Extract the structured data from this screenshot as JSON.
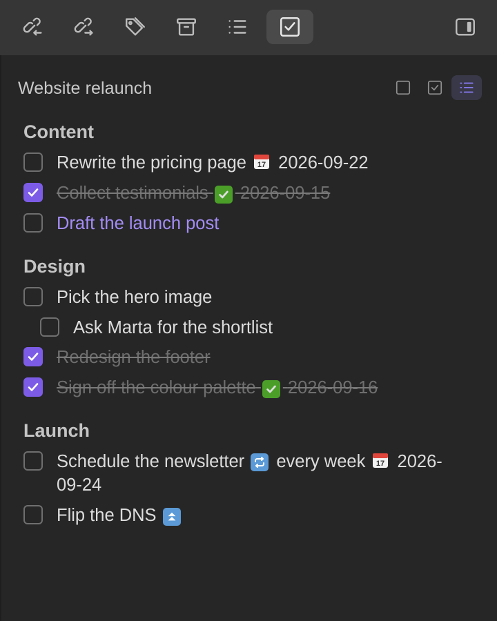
{
  "toolbar": {
    "buttons": [
      {
        "name": "backlinks-icon"
      },
      {
        "name": "outgoing-links-icon"
      },
      {
        "name": "tags-icon"
      },
      {
        "name": "archive-icon"
      },
      {
        "name": "outline-icon"
      },
      {
        "name": "tasks-icon",
        "active": true
      },
      {
        "name": "sidebar-toggle-icon"
      }
    ]
  },
  "panel": {
    "title": "Website relaunch",
    "view_modes": [
      "unchecked-square-icon",
      "checked-square-icon",
      "list-icon"
    ],
    "active_view": "list-icon"
  },
  "sections": [
    {
      "heading": "Content",
      "tasks": [
        {
          "text": "Rewrite the pricing page",
          "emoji": "calendar",
          "date": "2026-09-22",
          "done": false
        },
        {
          "text": "Collect testimonials",
          "emoji": "check",
          "date": "2026-09-15",
          "done": true
        },
        {
          "text": "Draft the launch post",
          "done": false,
          "link": true
        }
      ]
    },
    {
      "heading": "Design",
      "tasks": [
        {
          "text": "Pick the hero image",
          "done": false
        },
        {
          "text": "Ask Marta for the shortlist",
          "done": false,
          "indent": 1
        },
        {
          "text": "Redesign the footer",
          "done": true
        },
        {
          "text": "Sign off the colour palette",
          "emoji": "check",
          "date": "2026-09-16",
          "done": true
        }
      ]
    },
    {
      "heading": "Launch",
      "tasks": [
        {
          "text": "Schedule the newsletter",
          "emoji": "repeat",
          "recurrence": "every week",
          "emoji2": "calendar",
          "date_part1": "2026-",
          "date_part2": "09-24",
          "done": false
        },
        {
          "text": "Flip the DNS",
          "emoji": "priority-high",
          "done": false
        }
      ]
    }
  ],
  "colors": {
    "accent": "#7c5ce6",
    "link": "#a38cf5",
    "background": "#262626",
    "toolbar": "#363636"
  }
}
